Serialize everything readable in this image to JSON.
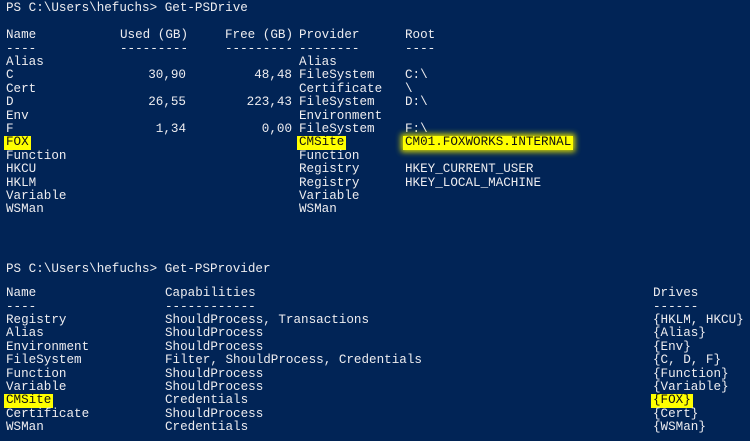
{
  "section1": {
    "prompt": "PS C:\\Users\\hefuchs> Get-PSDrive",
    "headers": [
      "Name",
      "Used (GB)",
      "Free (GB)",
      "Provider",
      "Root"
    ],
    "dashes": [
      "----",
      "---------",
      "---------",
      "--------",
      "----"
    ],
    "rows": [
      [
        "Alias",
        "",
        "",
        "Alias",
        ""
      ],
      [
        "C",
        "30,90",
        "48,48",
        "FileSystem",
        "C:\\"
      ],
      [
        "Cert",
        "",
        "",
        "Certificate",
        "\\"
      ],
      [
        "D",
        "26,55",
        "223,43",
        "FileSystem",
        "D:\\"
      ],
      [
        "Env",
        "",
        "",
        "Environment",
        ""
      ],
      [
        "F",
        "1,34",
        "0,00",
        "FileSystem",
        "F:\\"
      ],
      [
        "FOX",
        "",
        "",
        "CMSite",
        "CM01.FOXWORKS.INTERNAL"
      ],
      [
        "Function",
        "",
        "",
        "Function",
        ""
      ],
      [
        "HKCU",
        "",
        "",
        "Registry",
        "HKEY_CURRENT_USER"
      ],
      [
        "HKLM",
        "",
        "",
        "Registry",
        "HKEY_LOCAL_MACHINE"
      ],
      [
        "Variable",
        "",
        "",
        "Variable",
        ""
      ],
      [
        "WSMan",
        "",
        "",
        "WSMan",
        ""
      ]
    ]
  },
  "section2": {
    "prompt": "PS C:\\Users\\hefuchs> Get-PSProvider",
    "headers": [
      "Name",
      "Capabilities",
      "Drives"
    ],
    "dashes": [
      "----",
      "------------",
      "------"
    ],
    "rows": [
      [
        "Registry",
        "ShouldProcess, Transactions",
        "{HKLM, HKCU}"
      ],
      [
        "Alias",
        "ShouldProcess",
        "{Alias}"
      ],
      [
        "Environment",
        "ShouldProcess",
        "{Env}"
      ],
      [
        "FileSystem",
        "Filter, ShouldProcess, Credentials",
        "{C, D, F}"
      ],
      [
        "Function",
        "ShouldProcess",
        "{Function}"
      ],
      [
        "Variable",
        "ShouldProcess",
        "{Variable}"
      ],
      [
        "CMSite",
        "Credentials",
        "{FOX}"
      ],
      [
        "Certificate",
        "ShouldProcess",
        "{Cert}"
      ],
      [
        "WSMan",
        "Credentials",
        "{WSMan}"
      ]
    ]
  },
  "colors": {
    "background": "#012456",
    "text": "#eeedf0",
    "highlight": "#ffff00"
  }
}
